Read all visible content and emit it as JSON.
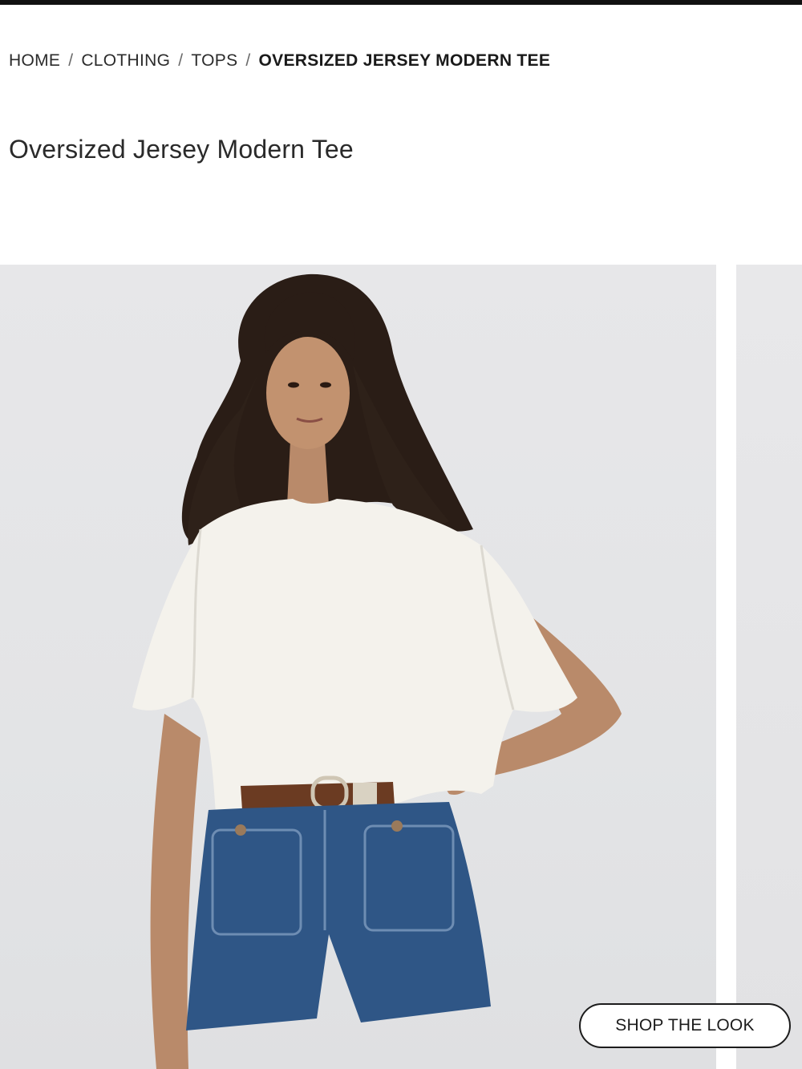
{
  "breadcrumb": {
    "items": [
      {
        "label": "HOME"
      },
      {
        "label": "CLOTHING"
      },
      {
        "label": "TOPS"
      }
    ],
    "separator": "/",
    "current": "OVERSIZED JERSEY MODERN TEE"
  },
  "product": {
    "title": "Oversized Jersey Modern Tee"
  },
  "gallery": {
    "shop_the_look_label": "SHOP THE LOOK"
  },
  "colors": {
    "text": "#2b2b2b",
    "top_bar": "#111111",
    "tee": "#f4f2ec",
    "denim": "#2f5686",
    "belt": "#6b3b22"
  }
}
